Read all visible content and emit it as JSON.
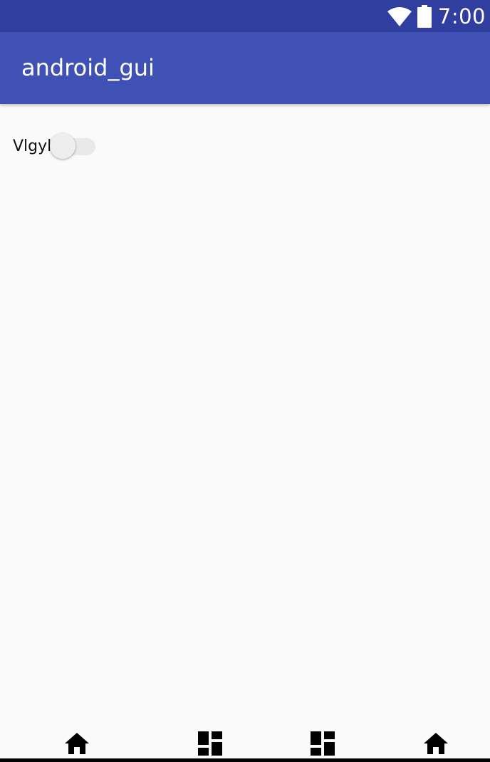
{
  "status_bar": {
    "time": "7:00",
    "icons": [
      "wifi-icon",
      "battery-icon"
    ],
    "color": "#303f9f"
  },
  "app_bar": {
    "title": "android_gui",
    "color": "#3f51b5"
  },
  "content": {
    "switch": {
      "label": "Vlgyl",
      "checked": false
    }
  },
  "bottom_nav": {
    "items": [
      {
        "icon": "home-icon"
      },
      {
        "icon": "dashboard-icon"
      },
      {
        "icon": "dashboard-icon"
      },
      {
        "icon": "home-icon"
      }
    ]
  }
}
